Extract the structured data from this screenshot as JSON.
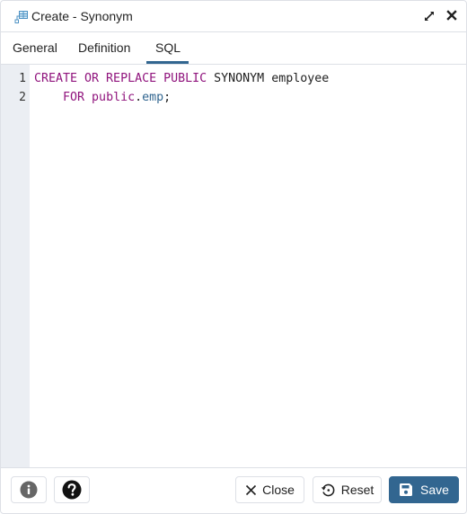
{
  "window": {
    "title": "Create - Synonym",
    "icon": "synonym-icon"
  },
  "title_controls": {
    "maximize": "maximize-icon",
    "close": "close-icon"
  },
  "tabs": [
    {
      "label": "General",
      "active": false
    },
    {
      "label": "Definition",
      "active": false
    },
    {
      "label": "SQL",
      "active": true
    }
  ],
  "editor": {
    "lines": [
      {
        "number": "1",
        "tokens": [
          {
            "text": "CREATE OR REPLACE PUBLIC",
            "type": "keyword"
          },
          {
            "text": " SYNONYM employee",
            "type": "plain"
          }
        ]
      },
      {
        "number": "2",
        "tokens": [
          {
            "text": "    ",
            "type": "plain"
          },
          {
            "text": "FOR public",
            "type": "keyword"
          },
          {
            "text": ".",
            "type": "plain"
          },
          {
            "text": "emp",
            "type": "variable"
          },
          {
            "text": ";",
            "type": "plain"
          }
        ]
      }
    ]
  },
  "footer": {
    "info_icon": "info-icon",
    "help_icon": "help-icon",
    "close_label": "Close",
    "reset_label": "Reset",
    "save_label": "Save"
  },
  "colors": {
    "accent": "#326690",
    "keyword": "#90147d",
    "gutter": "#ebeef3",
    "border": "#dde0e6"
  }
}
